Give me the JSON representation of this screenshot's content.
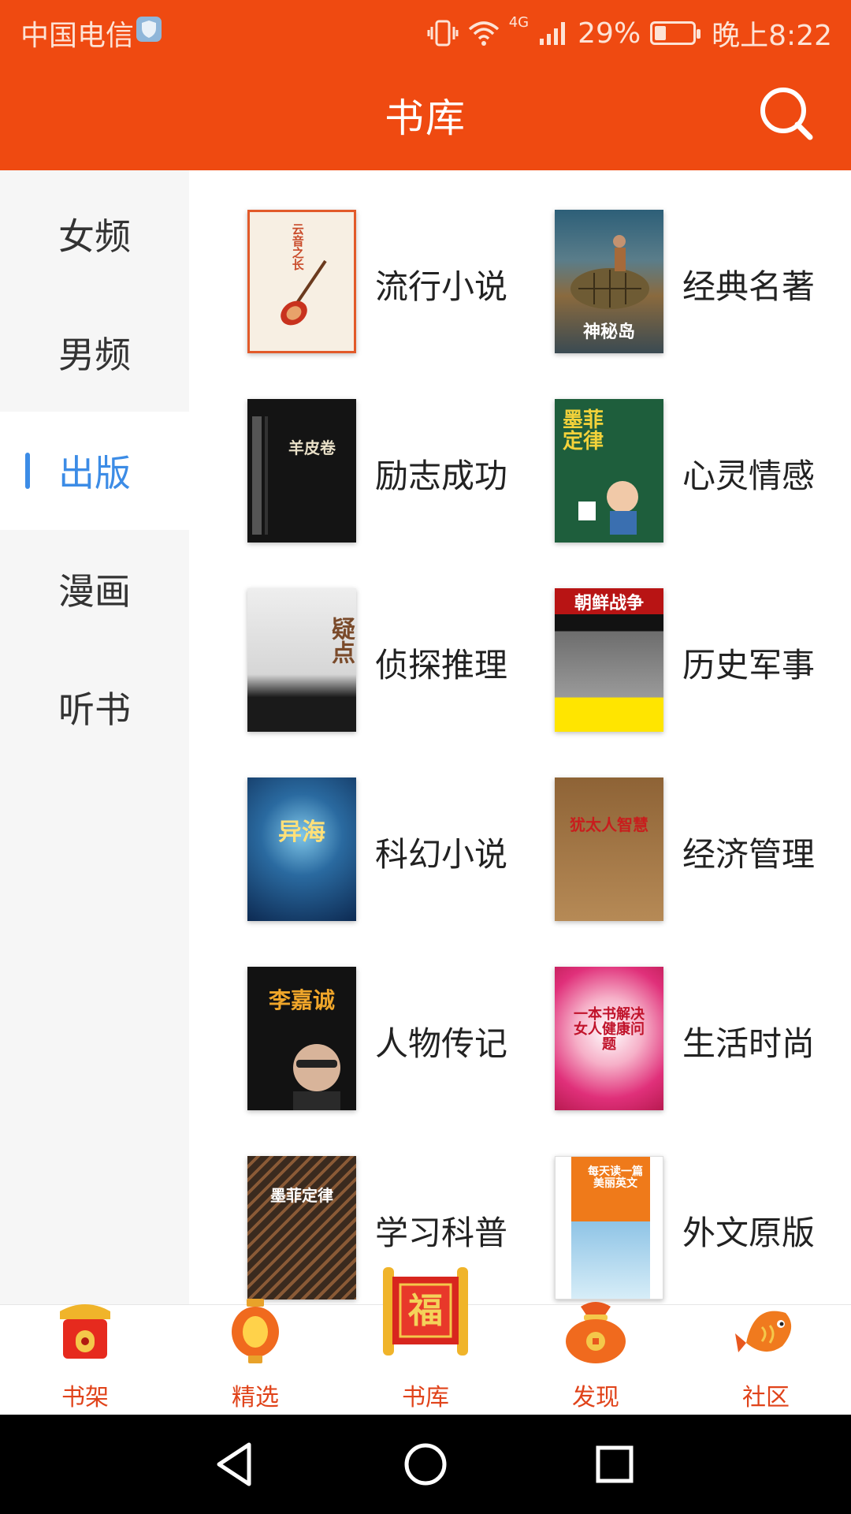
{
  "status_bar": {
    "carrier": "中国电信",
    "battery_text": "29%",
    "battery_level": 0.29,
    "time": "晚上8:22",
    "network": "4G"
  },
  "header": {
    "title": "书库"
  },
  "sidebar": {
    "items": [
      {
        "label": "女频",
        "active": false
      },
      {
        "label": "男频",
        "active": false
      },
      {
        "label": "出版",
        "active": true
      },
      {
        "label": "漫画",
        "active": false
      },
      {
        "label": "听书",
        "active": false
      }
    ]
  },
  "categories": [
    {
      "label": "流行小说",
      "cover_text": "云音之长"
    },
    {
      "label": "经典名著",
      "cover_text": "神秘岛"
    },
    {
      "label": "励志成功",
      "cover_text": "羊皮卷"
    },
    {
      "label": "心灵情感",
      "cover_text": "墨菲定律"
    },
    {
      "label": "侦探推理",
      "cover_text": "疑点"
    },
    {
      "label": "历史军事",
      "cover_text": "朝鲜战争"
    },
    {
      "label": "科幻小说",
      "cover_text": "异海"
    },
    {
      "label": "经济管理",
      "cover_text": "犹太人智慧"
    },
    {
      "label": "人物传记",
      "cover_text": "李嘉诚"
    },
    {
      "label": "生活时尚",
      "cover_text": "一本书解决女人健康问题"
    },
    {
      "label": "学习科普",
      "cover_text": "墨菲定律"
    },
    {
      "label": "外文原版",
      "cover_text": "每天读一篇美丽英文"
    }
  ],
  "tabbar": {
    "tabs": [
      {
        "label": "书架",
        "icon": "bookshelf-icon"
      },
      {
        "label": "精选",
        "icon": "lantern-icon"
      },
      {
        "label": "书库",
        "icon": "fu-scroll-icon",
        "active": true
      },
      {
        "label": "发现",
        "icon": "lucky-bag-icon"
      },
      {
        "label": "社区",
        "icon": "fish-icon"
      }
    ]
  },
  "colors": {
    "brand": "#ef4a11",
    "active_blue": "#3c8ce6",
    "tab_label": "#e0431a"
  }
}
